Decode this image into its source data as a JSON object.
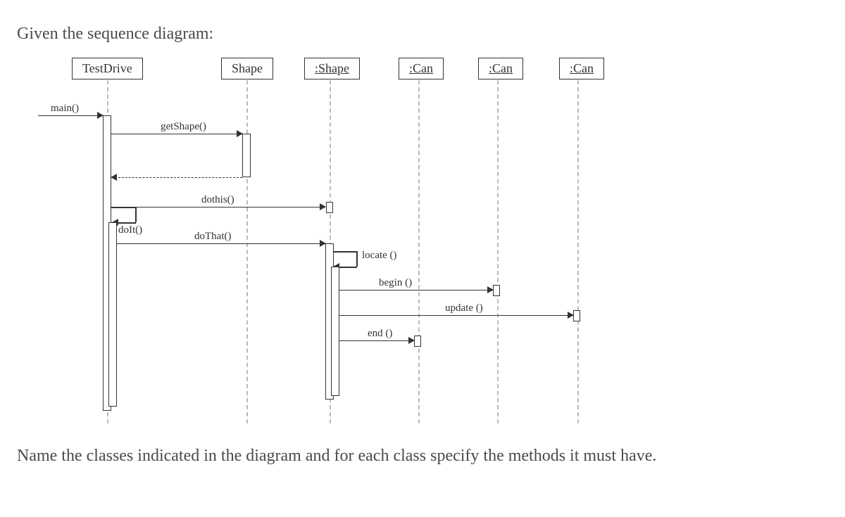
{
  "intro_text": "Given the sequence diagram:",
  "outro_text": "Name the classes indicated in the diagram and for each class specify the methods it must have.",
  "participants": {
    "p1": "TestDrive",
    "p2": "Shape",
    "p3": ":Shape",
    "p4": ":Can",
    "p5": ":Can",
    "p6": ":Can"
  },
  "messages": {
    "main": "main()",
    "getShape": "getShape()",
    "dothis": "dothis()",
    "doIt": "doIt()",
    "doThat": "doThat()",
    "locate": "locate ()",
    "begin": "begin ()",
    "update": "update ()",
    "end": "end ()"
  }
}
